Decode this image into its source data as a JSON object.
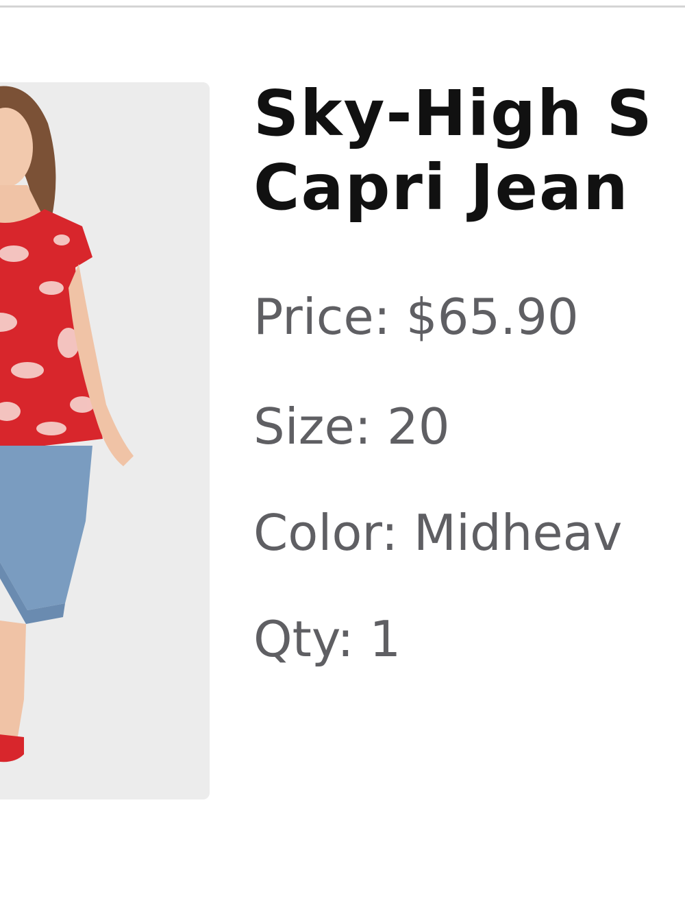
{
  "product": {
    "title_line1": "Sky-High S",
    "title_line2": "Capri Jean",
    "price_label": "Price:",
    "price_value": "$65.90",
    "size_label": "Size:",
    "size_value": "20",
    "color_label": "Color:",
    "color_value": "Midheav",
    "qty_label": "Qty:",
    "qty_value": "1"
  },
  "colors": {
    "title": "#111111",
    "detail_text": "#5f5f63",
    "image_background": "#ececec",
    "top_red": "#d8262c",
    "denim": "#7a9cc0"
  }
}
